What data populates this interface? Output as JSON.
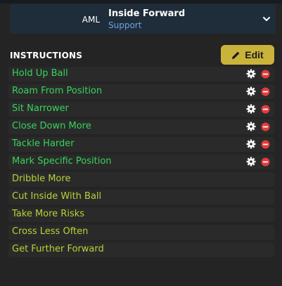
{
  "role": {
    "position": "AML",
    "name": "Inside Forward",
    "duty": "Support",
    "dropdown_icon": "chevron-down-icon"
  },
  "instructions": {
    "title": "INSTRUCTIONS",
    "edit_label": "Edit",
    "edit_icon": "pencil-icon",
    "active_color": "#37d45c",
    "inactive_color": "#b6d336",
    "gear_icon": "gear-icon",
    "remove_icon": "remove-circle-icon",
    "remove_color": "#e23c3c",
    "items": [
      {
        "label": "Hold Up Ball",
        "active": true
      },
      {
        "label": "Roam From Position",
        "active": true
      },
      {
        "label": "Sit Narrower",
        "active": true
      },
      {
        "label": "Close Down More",
        "active": true
      },
      {
        "label": "Tackle Harder",
        "active": true
      },
      {
        "label": "Mark Specific Position",
        "active": true
      },
      {
        "label": "Dribble More",
        "active": false
      },
      {
        "label": "Cut Inside With Ball",
        "active": false
      },
      {
        "label": "Take More Risks",
        "active": false
      },
      {
        "label": "Cross Less Often",
        "active": false
      },
      {
        "label": "Get Further Forward",
        "active": false
      }
    ]
  }
}
